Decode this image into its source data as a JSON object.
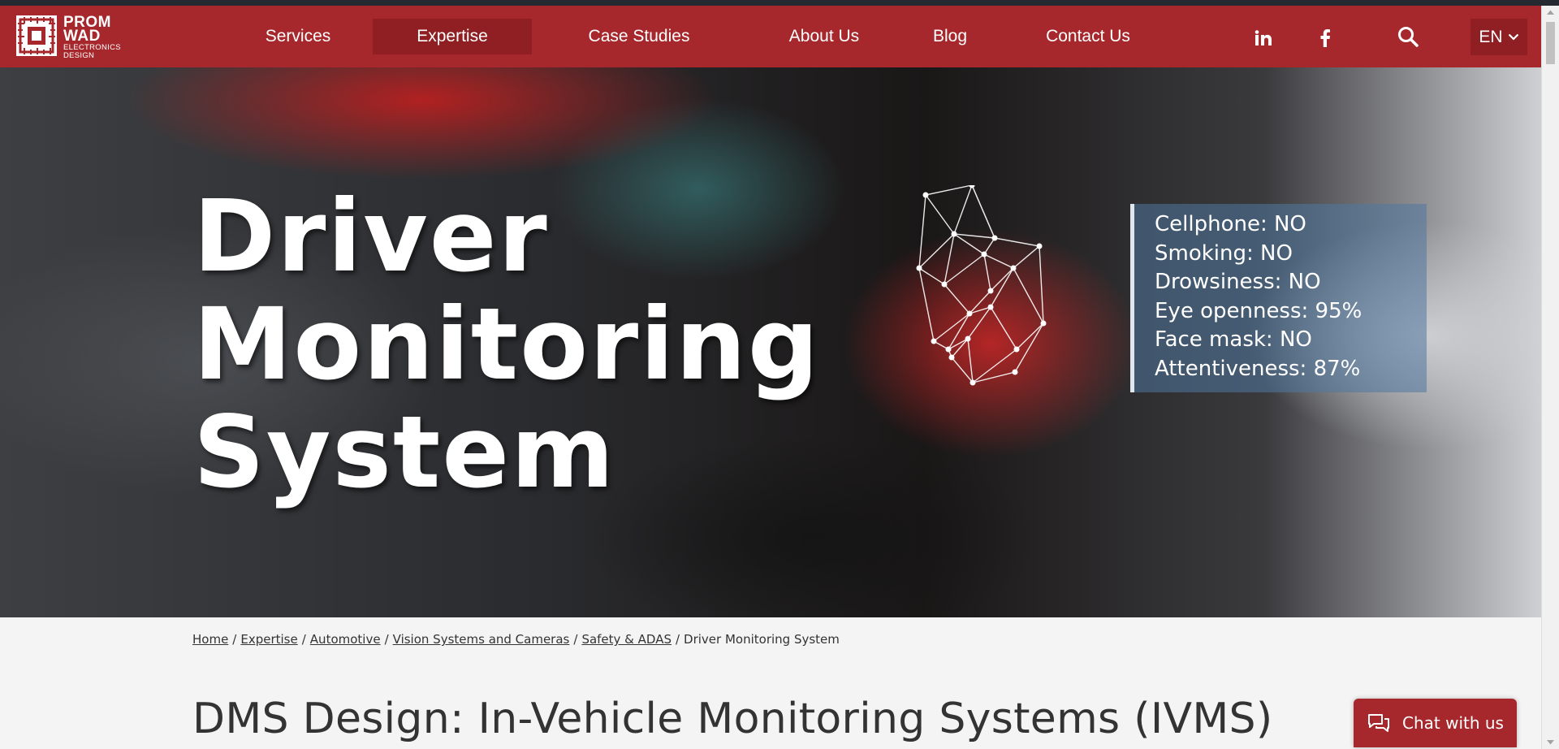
{
  "brand": {
    "name_line1": "PROM",
    "name_line2": "WAD",
    "tagline_line1": "ELECTRONICS",
    "tagline_line2": "DESIGN",
    "color": "#a7282c"
  },
  "nav": {
    "items": [
      {
        "label": "Services",
        "active": false
      },
      {
        "label": "Expertise",
        "active": true
      },
      {
        "label": "Case Studies",
        "active": false
      },
      {
        "label": "About Us",
        "active": false
      },
      {
        "label": "Blog",
        "active": false
      },
      {
        "label": "Contact Us",
        "active": false
      }
    ],
    "social": [
      "linkedin-icon",
      "facebook-icon"
    ],
    "search_icon": "search-icon",
    "language": "EN"
  },
  "hero": {
    "title_line1": "Driver",
    "title_line2": "Monitoring",
    "title_line3": "System",
    "stats": [
      "Cellphone: NO",
      "Smoking: NO",
      "Drowsiness: NO",
      "Eye openness: 95%",
      "Face mask: NO",
      "Attentiveness: 87%"
    ]
  },
  "breadcrumb": [
    {
      "label": "Home",
      "link": true
    },
    {
      "label": "Expertise",
      "link": true
    },
    {
      "label": "Automotive",
      "link": true
    },
    {
      "label": "Vision Systems and Cameras",
      "link": true
    },
    {
      "label": "Safety & ADAS",
      "link": true
    },
    {
      "label": "Driver Monitoring System",
      "link": false
    }
  ],
  "page": {
    "heading": "DMS Design: In-Vehicle Monitoring Systems (IVMS)"
  },
  "chat": {
    "label": "Chat with us",
    "icon": "chat-icon"
  }
}
